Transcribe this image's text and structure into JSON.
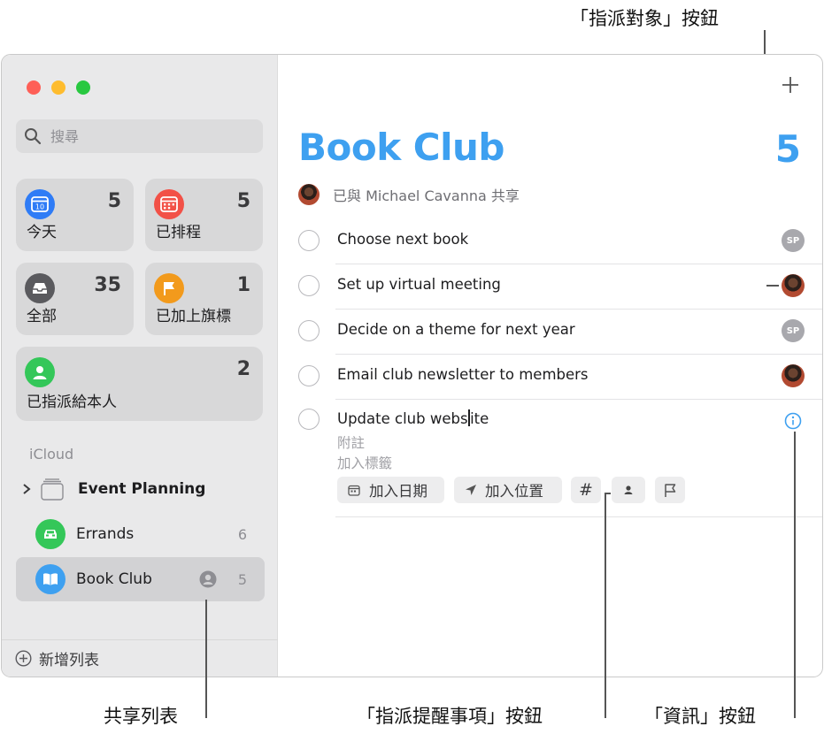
{
  "sidebar": {
    "search": {
      "placeholder": "搜尋"
    },
    "smart_lists": [
      {
        "label": "今天",
        "count": "5",
        "color": "#2f7cf6",
        "icon": "calendar-today-icon",
        "day": "10"
      },
      {
        "label": "已排程",
        "count": "5",
        "color": "#f25147",
        "icon": "calendar-scheduled-icon"
      },
      {
        "label": "全部",
        "count": "35",
        "color": "#5a5a5e",
        "icon": "tray-icon"
      },
      {
        "label": "已加上旗標",
        "count": "1",
        "color": "#f29a1c",
        "icon": "flag-icon"
      },
      {
        "label": "已指派給本人",
        "count": "2",
        "color": "#34c759",
        "icon": "person-icon"
      }
    ],
    "section": "iCloud",
    "lists": [
      {
        "name": "Event Planning",
        "count": "",
        "icon": "folder-group-icon"
      },
      {
        "name": "Errands",
        "count": "6",
        "color": "#34c759",
        "icon": "car-icon"
      },
      {
        "name": "Book Club",
        "count": "5",
        "color": "#3ea0f0",
        "icon": "book-icon",
        "shared": true
      }
    ],
    "add_list_label": "新增列表"
  },
  "main": {
    "title": "Book Club",
    "count": "5",
    "shared_text": "已與 Michael Cavanna 共享",
    "tasks": [
      {
        "text": "Choose next book",
        "assignee": "SP"
      },
      {
        "text": "Set up virtual meeting",
        "assignee": "photo"
      },
      {
        "text": "Decide on a theme for next year",
        "assignee": "SP"
      },
      {
        "text": "Email club newsletter to members",
        "assignee": "photo"
      }
    ],
    "editing_task": {
      "text_before_cursor": "Update club webs",
      "text_after_cursor": "ite",
      "notes_placeholder": "附註",
      "tags_placeholder": "加入標籤",
      "add_date_label": "加入日期",
      "add_location_label": "加入位置",
      "tag_symbol": "#"
    },
    "accent_color": "#3ea0f0"
  },
  "annotations": {
    "assign_button": "「指派對象」按鈕",
    "shared_list": "共享列表",
    "assign_reminder_button": "「指派提醒事項」按鈕",
    "info_button": "「資訊」按鈕"
  }
}
